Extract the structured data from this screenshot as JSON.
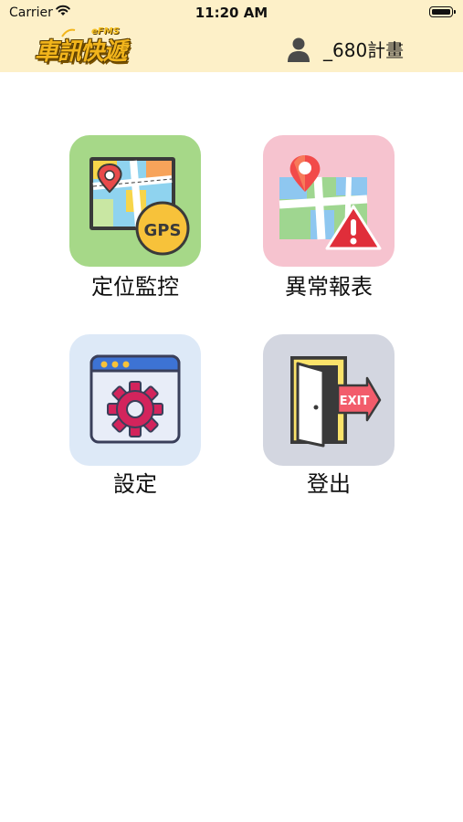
{
  "status_bar": {
    "carrier": "Carrier",
    "time": "11:20 AM"
  },
  "header": {
    "logo_text": "車訊快遞",
    "logo_sub": "eFMS",
    "user_name": "_680計畫",
    "background": "#fdf0c8"
  },
  "menu": {
    "items": [
      {
        "label": "定位監控",
        "icon": "gps-map-icon",
        "color": "#a6d888"
      },
      {
        "label": "異常報表",
        "icon": "map-alert-icon",
        "color": "#f6c3cf"
      },
      {
        "label": "設定",
        "icon": "settings-window-icon",
        "color": "#dde9f7"
      },
      {
        "label": "登出",
        "icon": "exit-door-icon",
        "color": "#d3d6e0"
      }
    ]
  }
}
